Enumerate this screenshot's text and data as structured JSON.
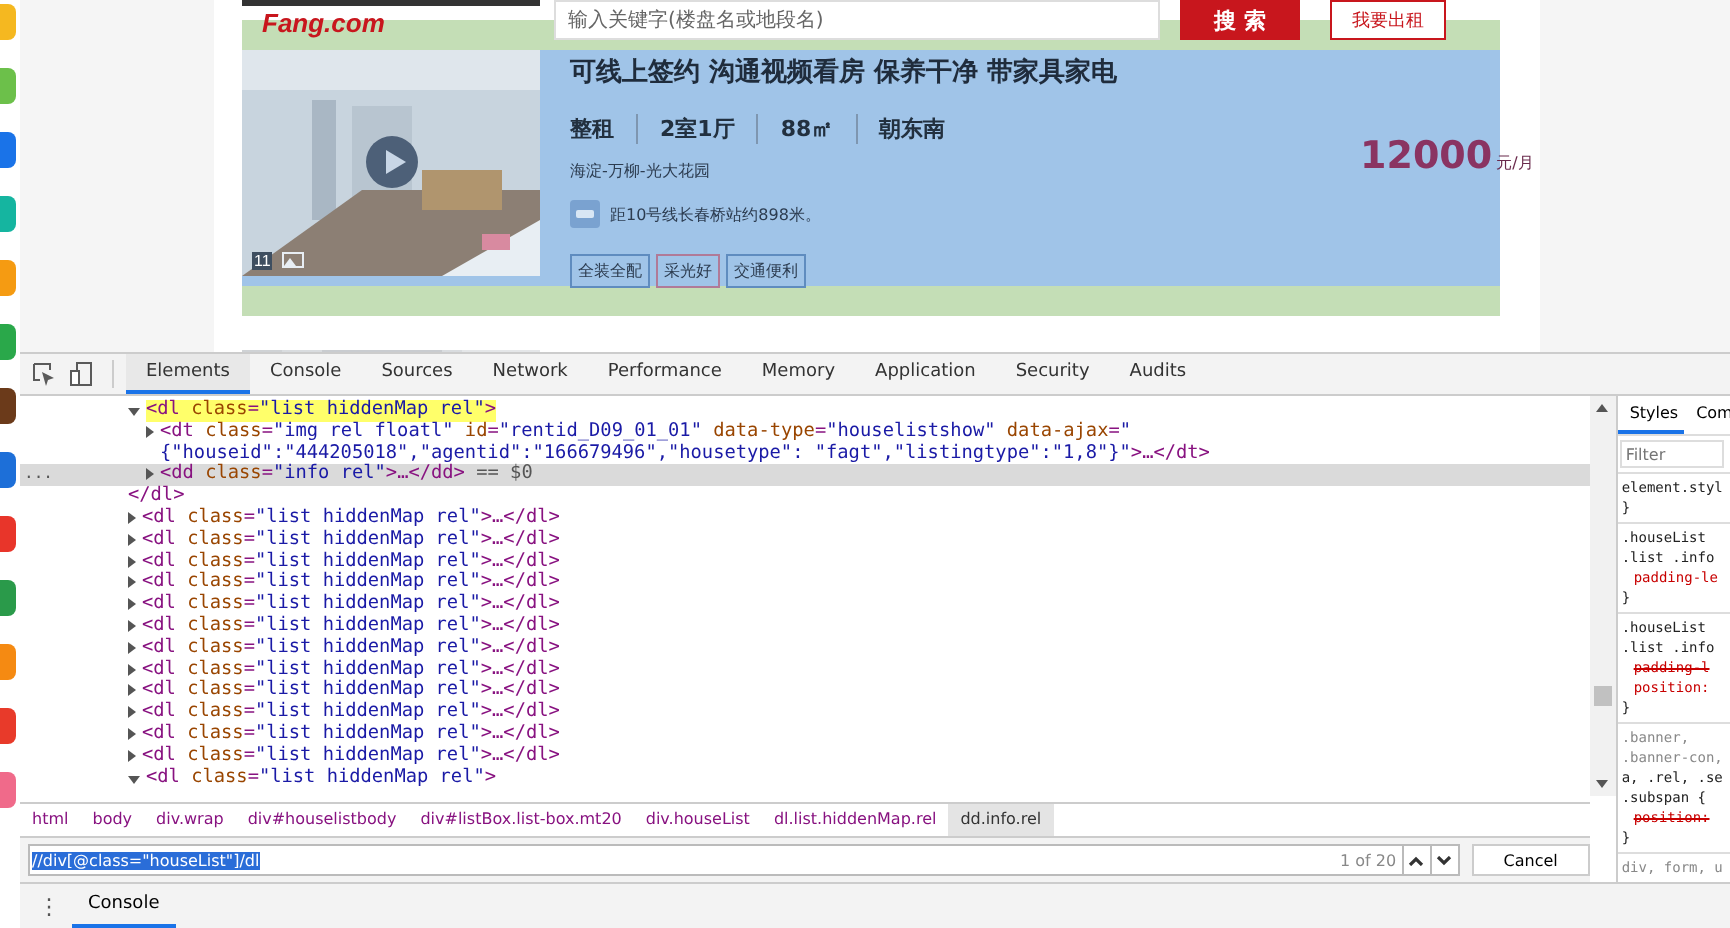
{
  "page": {
    "logo": "Fang.com",
    "search": {
      "placeholder": "输入关键字(楼盘名或地段名)"
    },
    "search_button": "搜 索",
    "rent_button": "我要出租",
    "listing": {
      "photo_count": "11",
      "title": "可线上签约 沟通视频看房 保养干净 带家具家电",
      "specs": [
        "整租",
        "2室1厅",
        "88㎡",
        "朝东南"
      ],
      "location": "海淀-万柳-光大花园",
      "subway": "距10号线长春桥站约898米。",
      "tags": [
        "全装全配",
        "采光好",
        "交通便利"
      ],
      "price": "12000",
      "price_unit": "元/月"
    }
  },
  "devtools": {
    "tabs": [
      {
        "label": "Elements",
        "selected": true
      },
      {
        "label": "Console",
        "selected": false
      },
      {
        "label": "Sources",
        "selected": false
      },
      {
        "label": "Network",
        "selected": false
      },
      {
        "label": "Performance",
        "selected": false
      },
      {
        "label": "Memory",
        "selected": false
      },
      {
        "label": "Application",
        "selected": false
      },
      {
        "label": "Security",
        "selected": false
      },
      {
        "label": "Audits",
        "selected": false
      }
    ],
    "dom_tree": [
      {
        "tokens": [
          {
            "kind": "tag",
            "text": "<dl"
          },
          {
            "kind": "attr",
            "text": " class"
          },
          {
            "kind": "plain",
            "text": "="
          },
          {
            "kind": "val",
            "text": "\"list hiddenMap rel\""
          },
          {
            "kind": "tag",
            "text": ">"
          }
        ],
        "expanded": true,
        "highlighted": true,
        "selected": false,
        "children": [
          {
            "tokens": [
              {
                "kind": "tag",
                "text": "<dt"
              },
              {
                "kind": "attr",
                "text": " class"
              },
              {
                "kind": "plain",
                "text": "="
              },
              {
                "kind": "val",
                "text": "\"img rel floatl\""
              },
              {
                "kind": "attr",
                "text": " id"
              },
              {
                "kind": "plain",
                "text": "="
              },
              {
                "kind": "val",
                "text": "\"rentid_D09_01_01\""
              },
              {
                "kind": "attr",
                "text": " data-type"
              },
              {
                "kind": "plain",
                "text": "="
              },
              {
                "kind": "val",
                "text": "\"houselistshow\""
              },
              {
                "kind": "attr",
                "text": " data-ajax"
              },
              {
                "kind": "plain",
                "text": "="
              },
              {
                "kind": "val",
                "text": "\"{\"houseid\":\"444205018\",\"agentid\":\"166679496\",\"housetype\": \"fagt\",\"listingtype\":\"1,8\"}\""
              },
              {
                "kind": "tag",
                "text": ">"
              },
              {
                "kind": "plain",
                "text": "…"
              },
              {
                "kind": "tag",
                "text": "</dt>"
              }
            ],
            "expanded": false,
            "highlighted": false,
            "selected": false
          },
          {
            "gutter": "...",
            "tokens": [
              {
                "kind": "tag",
                "text": "<dd"
              },
              {
                "kind": "attr",
                "text": " class"
              },
              {
                "kind": "plain",
                "text": "="
              },
              {
                "kind": "val",
                "text": "\"info rel\""
              },
              {
                "kind": "tag",
                "text": ">"
              },
              {
                "kind": "plain",
                "text": "…"
              },
              {
                "kind": "tag",
                "text": "</dd>"
              },
              {
                "kind": "dim",
                "text": " == $0"
              }
            ],
            "expanded": false,
            "highlighted": false,
            "selected": true
          }
        ],
        "closing": [
          {
            "kind": "tag",
            "text": "</dl>"
          }
        ]
      },
      {
        "tokens": [
          {
            "kind": "tag",
            "text": "<dl"
          },
          {
            "kind": "attr",
            "text": " class"
          },
          {
            "kind": "plain",
            "text": "="
          },
          {
            "kind": "val",
            "text": "\"list hiddenMap rel\""
          },
          {
            "kind": "tag",
            "text": ">"
          },
          {
            "kind": "plain",
            "text": "…"
          },
          {
            "kind": "tag",
            "text": "</dl>"
          }
        ],
        "expanded": false,
        "highlighted": false,
        "selected": false
      },
      {
        "tokens": [
          {
            "kind": "tag",
            "text": "<dl"
          },
          {
            "kind": "attr",
            "text": " class"
          },
          {
            "kind": "plain",
            "text": "="
          },
          {
            "kind": "val",
            "text": "\"list hiddenMap rel\""
          },
          {
            "kind": "tag",
            "text": ">"
          },
          {
            "kind": "plain",
            "text": "…"
          },
          {
            "kind": "tag",
            "text": "</dl>"
          }
        ],
        "expanded": false,
        "highlighted": false,
        "selected": false
      },
      {
        "tokens": [
          {
            "kind": "tag",
            "text": "<dl"
          },
          {
            "kind": "attr",
            "text": " class"
          },
          {
            "kind": "plain",
            "text": "="
          },
          {
            "kind": "val",
            "text": "\"list hiddenMap rel\""
          },
          {
            "kind": "tag",
            "text": ">"
          },
          {
            "kind": "plain",
            "text": "…"
          },
          {
            "kind": "tag",
            "text": "</dl>"
          }
        ],
        "expanded": false,
        "highlighted": false,
        "selected": false
      },
      {
        "tokens": [
          {
            "kind": "tag",
            "text": "<dl"
          },
          {
            "kind": "attr",
            "text": " class"
          },
          {
            "kind": "plain",
            "text": "="
          },
          {
            "kind": "val",
            "text": "\"list hiddenMap rel\""
          },
          {
            "kind": "tag",
            "text": ">"
          },
          {
            "kind": "plain",
            "text": "…"
          },
          {
            "kind": "tag",
            "text": "</dl>"
          }
        ],
        "expanded": false,
        "highlighted": false,
        "selected": false
      },
      {
        "tokens": [
          {
            "kind": "tag",
            "text": "<dl"
          },
          {
            "kind": "attr",
            "text": " class"
          },
          {
            "kind": "plain",
            "text": "="
          },
          {
            "kind": "val",
            "text": "\"list hiddenMap rel\""
          },
          {
            "kind": "tag",
            "text": ">"
          },
          {
            "kind": "plain",
            "text": "…"
          },
          {
            "kind": "tag",
            "text": "</dl>"
          }
        ],
        "expanded": false,
        "highlighted": false,
        "selected": false
      },
      {
        "tokens": [
          {
            "kind": "tag",
            "text": "<dl"
          },
          {
            "kind": "attr",
            "text": " class"
          },
          {
            "kind": "plain",
            "text": "="
          },
          {
            "kind": "val",
            "text": "\"list hiddenMap rel\""
          },
          {
            "kind": "tag",
            "text": ">"
          },
          {
            "kind": "plain",
            "text": "…"
          },
          {
            "kind": "tag",
            "text": "</dl>"
          }
        ],
        "expanded": false,
        "highlighted": false,
        "selected": false
      },
      {
        "tokens": [
          {
            "kind": "tag",
            "text": "<dl"
          },
          {
            "kind": "attr",
            "text": " class"
          },
          {
            "kind": "plain",
            "text": "="
          },
          {
            "kind": "val",
            "text": "\"list hiddenMap rel\""
          },
          {
            "kind": "tag",
            "text": ">"
          },
          {
            "kind": "plain",
            "text": "…"
          },
          {
            "kind": "tag",
            "text": "</dl>"
          }
        ],
        "expanded": false,
        "highlighted": false,
        "selected": false
      },
      {
        "tokens": [
          {
            "kind": "tag",
            "text": "<dl"
          },
          {
            "kind": "attr",
            "text": " class"
          },
          {
            "kind": "plain",
            "text": "="
          },
          {
            "kind": "val",
            "text": "\"list hiddenMap rel\""
          },
          {
            "kind": "tag",
            "text": ">"
          },
          {
            "kind": "plain",
            "text": "…"
          },
          {
            "kind": "tag",
            "text": "</dl>"
          }
        ],
        "expanded": false,
        "highlighted": false,
        "selected": false
      },
      {
        "tokens": [
          {
            "kind": "tag",
            "text": "<dl"
          },
          {
            "kind": "attr",
            "text": " class"
          },
          {
            "kind": "plain",
            "text": "="
          },
          {
            "kind": "val",
            "text": "\"list hiddenMap rel\""
          },
          {
            "kind": "tag",
            "text": ">"
          },
          {
            "kind": "plain",
            "text": "…"
          },
          {
            "kind": "tag",
            "text": "</dl>"
          }
        ],
        "expanded": false,
        "highlighted": false,
        "selected": false
      },
      {
        "tokens": [
          {
            "kind": "tag",
            "text": "<dl"
          },
          {
            "kind": "attr",
            "text": " class"
          },
          {
            "kind": "plain",
            "text": "="
          },
          {
            "kind": "val",
            "text": "\"list hiddenMap rel\""
          },
          {
            "kind": "tag",
            "text": ">"
          },
          {
            "kind": "plain",
            "text": "…"
          },
          {
            "kind": "tag",
            "text": "</dl>"
          }
        ],
        "expanded": false,
        "highlighted": false,
        "selected": false
      },
      {
        "tokens": [
          {
            "kind": "tag",
            "text": "<dl"
          },
          {
            "kind": "attr",
            "text": " class"
          },
          {
            "kind": "plain",
            "text": "="
          },
          {
            "kind": "val",
            "text": "\"list hiddenMap rel\""
          },
          {
            "kind": "tag",
            "text": ">"
          },
          {
            "kind": "plain",
            "text": "…"
          },
          {
            "kind": "tag",
            "text": "</dl>"
          }
        ],
        "expanded": false,
        "highlighted": false,
        "selected": false
      },
      {
        "tokens": [
          {
            "kind": "tag",
            "text": "<dl"
          },
          {
            "kind": "attr",
            "text": " class"
          },
          {
            "kind": "plain",
            "text": "="
          },
          {
            "kind": "val",
            "text": "\"list hiddenMap rel\""
          },
          {
            "kind": "tag",
            "text": ">"
          },
          {
            "kind": "plain",
            "text": "…"
          },
          {
            "kind": "tag",
            "text": "</dl>"
          }
        ],
        "expanded": false,
        "highlighted": false,
        "selected": false
      },
      {
        "tokens": [
          {
            "kind": "tag",
            "text": "<dl"
          },
          {
            "kind": "attr",
            "text": " class"
          },
          {
            "kind": "plain",
            "text": "="
          },
          {
            "kind": "val",
            "text": "\"list hiddenMap rel\""
          },
          {
            "kind": "tag",
            "text": ">"
          }
        ],
        "expanded": true,
        "highlighted": false,
        "selected": false
      }
    ],
    "breadcrumbs": [
      {
        "label": "html",
        "selected": false
      },
      {
        "label": "body",
        "selected": false
      },
      {
        "label": "div.wrap",
        "selected": false
      },
      {
        "label": "div#houselistbody",
        "selected": false
      },
      {
        "label": "div#listBox.list-box.mt20",
        "selected": false
      },
      {
        "label": "div.houseList",
        "selected": false
      },
      {
        "label": "dl.list.hiddenMap.rel",
        "selected": false
      },
      {
        "label": "dd.info.rel",
        "selected": true
      }
    ],
    "find": {
      "value": "//div[@class=\"houseList\"]/dl",
      "match_count": "1 of 20",
      "cancel": "Cancel"
    },
    "styles": {
      "tabs": [
        {
          "label": "Styles",
          "selected": true
        },
        {
          "label": "Com",
          "selected": false
        }
      ],
      "filter": {
        "placeholder": "Filter"
      },
      "rules": [
        {
          "lines": [
            {
              "kind": "selector",
              "text": "element.styl"
            },
            {
              "kind": "brace",
              "text": "}"
            }
          ]
        },
        {
          "lines": [
            {
              "kind": "selector",
              "text": ".houseList"
            },
            {
              "kind": "selector",
              "text": ".list .info"
            },
            {
              "kind": "prop",
              "text": "padding-le",
              "struck": false
            },
            {
              "kind": "brace",
              "text": "}"
            }
          ]
        },
        {
          "lines": [
            {
              "kind": "selector",
              "text": ".houseList"
            },
            {
              "kind": "selector",
              "text": ".list .info"
            },
            {
              "kind": "prop",
              "text": "padding-l",
              "struck": true
            },
            {
              "kind": "prop",
              "text": "position:",
              "struck": false
            },
            {
              "kind": "brace",
              "text": "}"
            }
          ]
        },
        {
          "lines": [
            {
              "kind": "dimselector",
              "text": ".banner,"
            },
            {
              "kind": "dimselector",
              "text": ".banner-con,"
            },
            {
              "kind": "selector",
              "text": "a, .rel, .se"
            },
            {
              "kind": "selector",
              "text": ".subspan {"
            },
            {
              "kind": "prop",
              "text": "position:",
              "struck": true
            },
            {
              "kind": "brace",
              "text": "}"
            }
          ]
        },
        {
          "lines": [
            {
              "kind": "dimselector",
              "text": "div, form, u"
            }
          ]
        }
      ]
    },
    "drawer": {
      "menu": "⋮",
      "tabs": [
        {
          "label": "Console",
          "selected": true
        }
      ]
    }
  }
}
